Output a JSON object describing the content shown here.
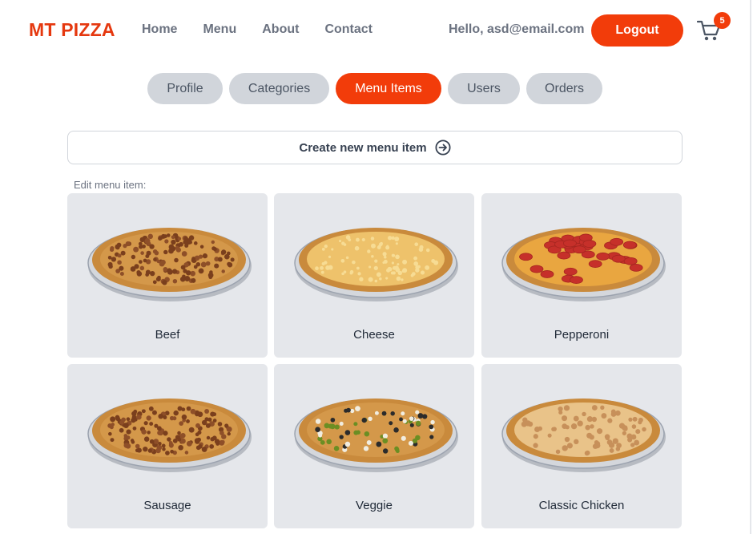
{
  "header": {
    "logo": "MT PIZZA",
    "nav": [
      "Home",
      "Menu",
      "About",
      "Contact"
    ],
    "greeting": "Hello, asd@email.com",
    "logout_label": "Logout",
    "cart_count": "5"
  },
  "tabs": [
    {
      "label": "Profile",
      "active": false
    },
    {
      "label": "Categories",
      "active": false
    },
    {
      "label": "Menu Items",
      "active": true
    },
    {
      "label": "Users",
      "active": false
    },
    {
      "label": "Orders",
      "active": false
    }
  ],
  "create_label": "Create new menu item",
  "edit_label": "Edit menu item:",
  "items": [
    {
      "name": "Beef",
      "topping": "beef"
    },
    {
      "name": "Cheese",
      "topping": "cheese"
    },
    {
      "name": "Pepperoni",
      "topping": "pepperoni"
    },
    {
      "name": "Sausage",
      "topping": "sausage"
    },
    {
      "name": "Veggie",
      "topping": "veggie"
    },
    {
      "name": "Classic Chicken",
      "topping": "chicken"
    }
  ],
  "colors": {
    "brand": "#e5380f",
    "accent": "#f23c0a",
    "tab_inactive": "#d1d5db",
    "card_bg": "#e5e7eb"
  }
}
